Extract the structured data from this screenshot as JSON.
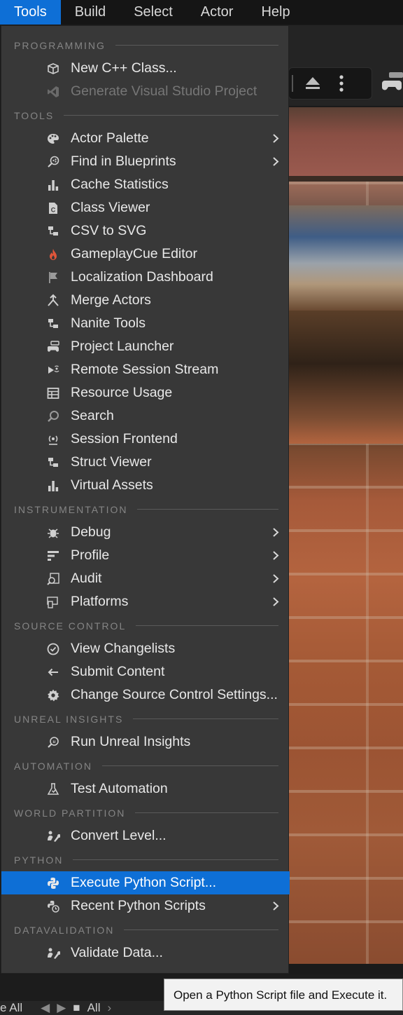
{
  "menubar": {
    "items": [
      {
        "label": "Tools",
        "active": true
      },
      {
        "label": "Build"
      },
      {
        "label": "Select"
      },
      {
        "label": "Actor"
      },
      {
        "label": "Help"
      }
    ]
  },
  "menu": {
    "sections": {
      "programming": "PROGRAMMING",
      "tools": "TOOLS",
      "instrumentation": "INSTRUMENTATION",
      "source_control": "SOURCE CONTROL",
      "unreal_insights": "UNREAL INSIGHTS",
      "automation": "AUTOMATION",
      "world_partition": "WORLD PARTITION",
      "python": "PYTHON",
      "datavalidation": "DATAVALIDATION"
    },
    "items": {
      "new_cpp_class": "New C++ Class...",
      "generate_vs_project": "Generate Visual Studio Project",
      "actor_palette": "Actor Palette",
      "find_in_blueprints": "Find in Blueprints",
      "cache_statistics": "Cache Statistics",
      "class_viewer": "Class Viewer",
      "csv_to_svg": "CSV to SVG",
      "gameplaycue_editor": "GameplayCue Editor",
      "localization_dashboard": "Localization Dashboard",
      "merge_actors": "Merge Actors",
      "nanite_tools": "Nanite Tools",
      "project_launcher": "Project Launcher",
      "remote_session_stream": "Remote Session Stream",
      "resource_usage": "Resource Usage",
      "search": "Search",
      "session_frontend": "Session Frontend",
      "struct_viewer": "Struct Viewer",
      "virtual_assets": "Virtual Assets",
      "debug": "Debug",
      "profile": "Profile",
      "audit": "Audit",
      "platforms": "Platforms",
      "view_changelists": "View Changelists",
      "submit_content": "Submit Content",
      "change_source_control_settings": "Change Source Control Settings...",
      "run_unreal_insights": "Run Unreal Insights",
      "test_automation": "Test Automation",
      "convert_level": "Convert Level...",
      "execute_python_script": "Execute Python Script...",
      "recent_python_scripts": "Recent Python Scripts",
      "validate_data": "Validate Data..."
    },
    "highlighted": "execute_python_script"
  },
  "tooltip": {
    "text": "Open a Python Script file and Execute it."
  },
  "content_bar": {
    "save_all": "e All",
    "all": "All"
  },
  "colors": {
    "accent": "#0e6fd6",
    "menu_bg": "#383838",
    "menubar_bg": "#151515",
    "section_text": "#858585",
    "disabled_text": "#767676",
    "gameplaycue_icon": "#e0553a"
  }
}
